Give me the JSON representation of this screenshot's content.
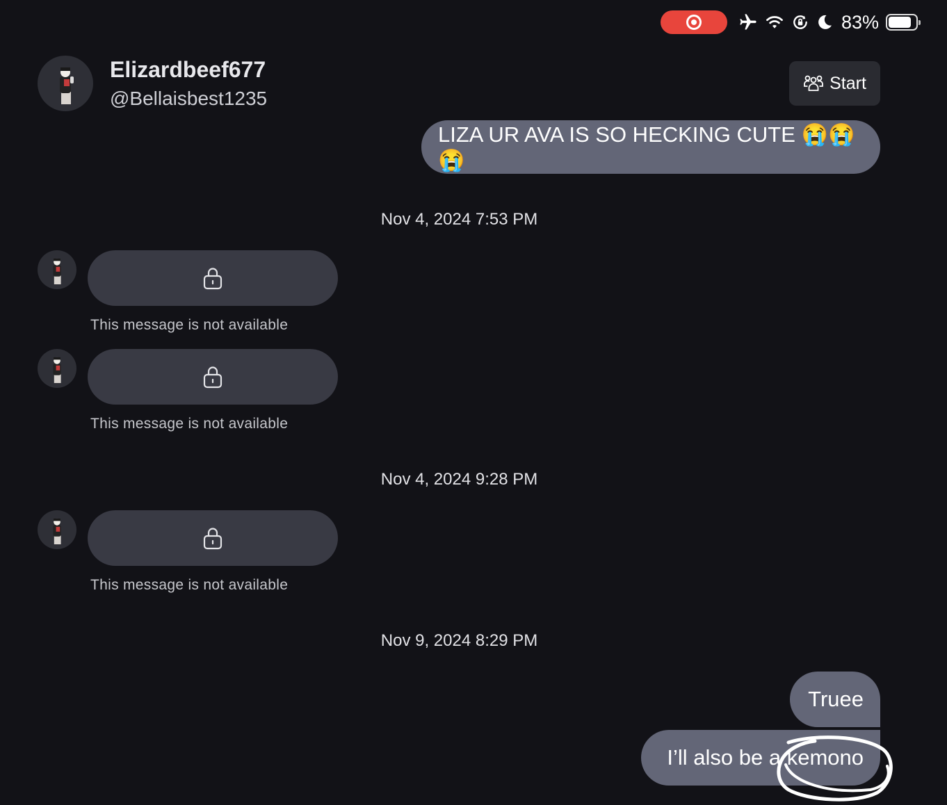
{
  "status_bar": {
    "battery_percent": "83%",
    "battery_level": 0.83,
    "icons": [
      "screen-record-icon",
      "airplane-icon",
      "wifi-icon",
      "orientation-lock-icon",
      "moon-icon",
      "battery-icon"
    ],
    "record_color": "#e8453c"
  },
  "header": {
    "display_name": "Elizardbeef677",
    "username": "@Bellaisbest1235",
    "start_label": "Start"
  },
  "messages": {
    "outgoing_1": "LIZA UR AVA IS SO HECKING CUTE 😭😭😭",
    "timestamp_1": "Nov 4, 2024 7:53 PM",
    "locked_1_caption": "This message is not available",
    "locked_2_caption": "This message is not available",
    "timestamp_2": "Nov 4, 2024 9:28 PM",
    "locked_3_caption": "This message is not available",
    "timestamp_3": "Nov 9, 2024 8:29 PM",
    "outgoing_2": "Truee",
    "outgoing_3": "I’ll also be a kemono"
  },
  "colors": {
    "background": "#121217",
    "outgoing_bubble": "#636677",
    "locked_bubble": "#393a44"
  }
}
